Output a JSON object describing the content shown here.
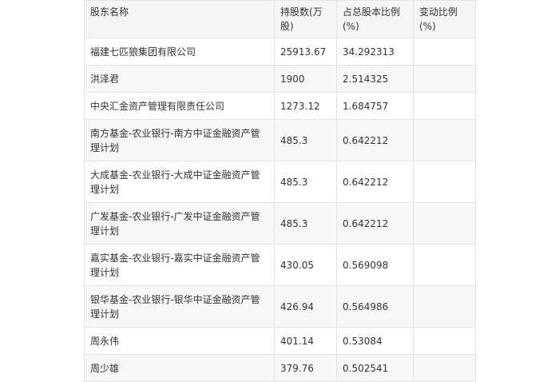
{
  "table": {
    "headers": [
      "股东名称",
      "持股数(万股)",
      "占总股本比例(%)",
      "变动比例(%)"
    ],
    "rows": [
      [
        "福建七匹狼集团有限公司",
        "25913.67",
        "34.292313",
        ""
      ],
      [
        "洪泽君",
        "1900",
        "2.514325",
        ""
      ],
      [
        "中央汇金资产管理有限责任公司",
        "1273.12",
        "1.684757",
        ""
      ],
      [
        "南方基金-农业银行-南方中证金融资产管理计划",
        "485.3",
        "0.642212",
        ""
      ],
      [
        "大成基金-农业银行-大成中证金融资产管理计划",
        "485.3",
        "0.642212",
        ""
      ],
      [
        "广发基金-农业银行-广发中证金融资产管理计划",
        "485.3",
        "0.642212",
        ""
      ],
      [
        "嘉实基金-农业银行-嘉实中证金融资产管理计划",
        "430.05",
        "0.569098",
        ""
      ],
      [
        "银华基金-农业银行-银华中证金融资产管理计划",
        "426.94",
        "0.564986",
        ""
      ],
      [
        "周永伟",
        "401.14",
        "0.53084",
        ""
      ],
      [
        "周少雄",
        "379.76",
        "0.502541",
        ""
      ]
    ]
  }
}
